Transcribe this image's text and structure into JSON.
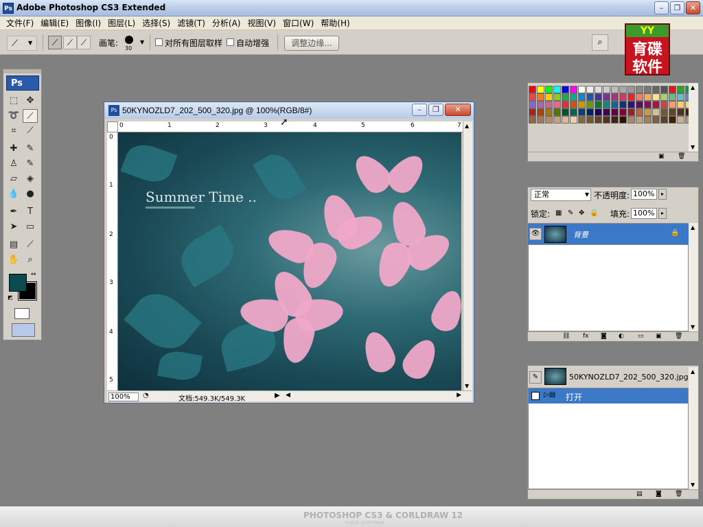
{
  "app": {
    "title": "Adobe Photoshop CS3 Extended"
  },
  "menu": [
    "文件(F)",
    "编辑(E)",
    "图像(I)",
    "图层(L)",
    "选择(S)",
    "滤镜(T)",
    "分析(A)",
    "视图(V)",
    "窗口(W)",
    "帮助(H)"
  ],
  "options": {
    "brush_label": "画笔:",
    "brush_size": "30",
    "sample_all_layers": "对所有图层取样",
    "auto_enhance": "自动增强",
    "refine_edge": "调整边缘..."
  },
  "logo": {
    "brand": "YY",
    "line1": "育碟",
    "line2": "软件"
  },
  "toolbox": {
    "logo": "Ps"
  },
  "document": {
    "title": "50KYNOZLD7_202_500_320.jpg @ 100%(RGB/8#)",
    "zoom": "100%",
    "docinfo": "文档:549.3K/549.3K",
    "overlay_text": "Summer Time ..",
    "ruler_h": [
      "0",
      "1",
      "2",
      "3",
      "4",
      "5",
      "6",
      "7"
    ],
    "ruler_v": [
      "0",
      "1",
      "2",
      "3",
      "4",
      "5"
    ]
  },
  "swatches": {
    "colors": [
      "#ff0000",
      "#ffff00",
      "#00ff00",
      "#00ffff",
      "#0000ff",
      "#ff00ff",
      "#ffffff",
      "#eeeeee",
      "#dddddd",
      "#cccccc",
      "#bbbbbb",
      "#aaaaaa",
      "#999999",
      "#888888",
      "#777777",
      "#666666",
      "#555555",
      "#ee1111",
      "#22aa22",
      "#119944",
      "#ee4444",
      "#ff7711",
      "#ffcc00",
      "#88cc22",
      "#22aa44",
      "#11aa88",
      "#1188cc",
      "#2255aa",
      "#443399",
      "#773399",
      "#aa3377",
      "#dd3366",
      "#ee2222",
      "#f08060",
      "#ffaa55",
      "#ffe088",
      "#aad06a",
      "#66bb88",
      "#66bbcc",
      "#6688cc",
      "#8866cc",
      "#aa66aa",
      "#cc6699",
      "#ee6688",
      "#dd3333",
      "#cc5511",
      "#cc9900",
      "#669911",
      "#117733",
      "#118877",
      "#116699",
      "#113377",
      "#331177",
      "#551166",
      "#881155",
      "#aa1144",
      "#cc4444",
      "#ff9966",
      "#ffcc66",
      "#eedd88",
      "#aa2222",
      "#aa4400",
      "#aa7700",
      "#557700",
      "#005522",
      "#006655",
      "#004477",
      "#002266",
      "#220066",
      "#440055",
      "#660044",
      "#880033",
      "#992222",
      "#bb6633",
      "#cc9944",
      "#d8c090",
      "#775533",
      "#664422",
      "#553311",
      "#442200",
      "#996644",
      "#aa7755",
      "#bb8866",
      "#c8a078",
      "#d8b898",
      "#e8d0b0",
      "#886644",
      "#775533",
      "#664422",
      "#553322",
      "#442211",
      "#331100",
      "#aa8866",
      "#c0a080",
      "#a08060",
      "#806040",
      "#604020",
      "#402000",
      "#c8b090",
      "#b09870"
    ]
  },
  "layers": {
    "blend_mode": "正常",
    "opacity_label": "不透明度:",
    "opacity": "100%",
    "lock_label": "锁定:",
    "fill_label": "填充:",
    "fill": "100%",
    "layer_name": "背景"
  },
  "history": {
    "snapshot": "50KYNOZLD7_202_500_320.jpg",
    "step": "打开"
  },
  "banner": {
    "text": "PHOTOSHOP CS3 & CORLDRAW 12",
    "sub": "YUDIE SOFTWAR"
  }
}
